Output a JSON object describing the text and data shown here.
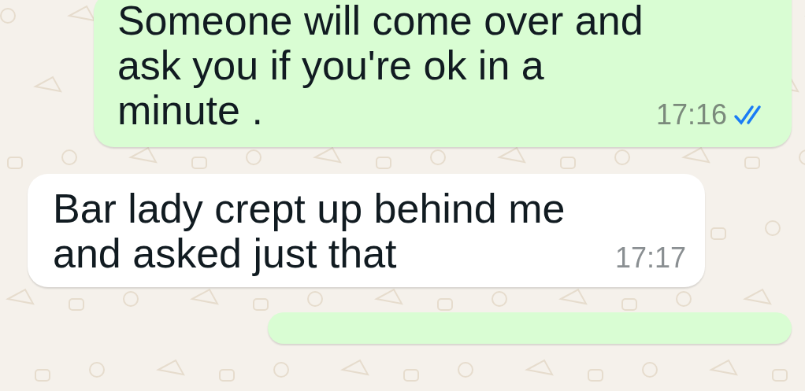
{
  "messages": [
    {
      "kind": "outgoing",
      "text": "Someone will come over and ask you if you're ok in a minute .",
      "time": "17:16",
      "read": true
    },
    {
      "kind": "incoming",
      "text": "Bar lady crept up behind me and asked just that",
      "time": "17:17"
    },
    {
      "kind": "outgoing"
    }
  ]
}
